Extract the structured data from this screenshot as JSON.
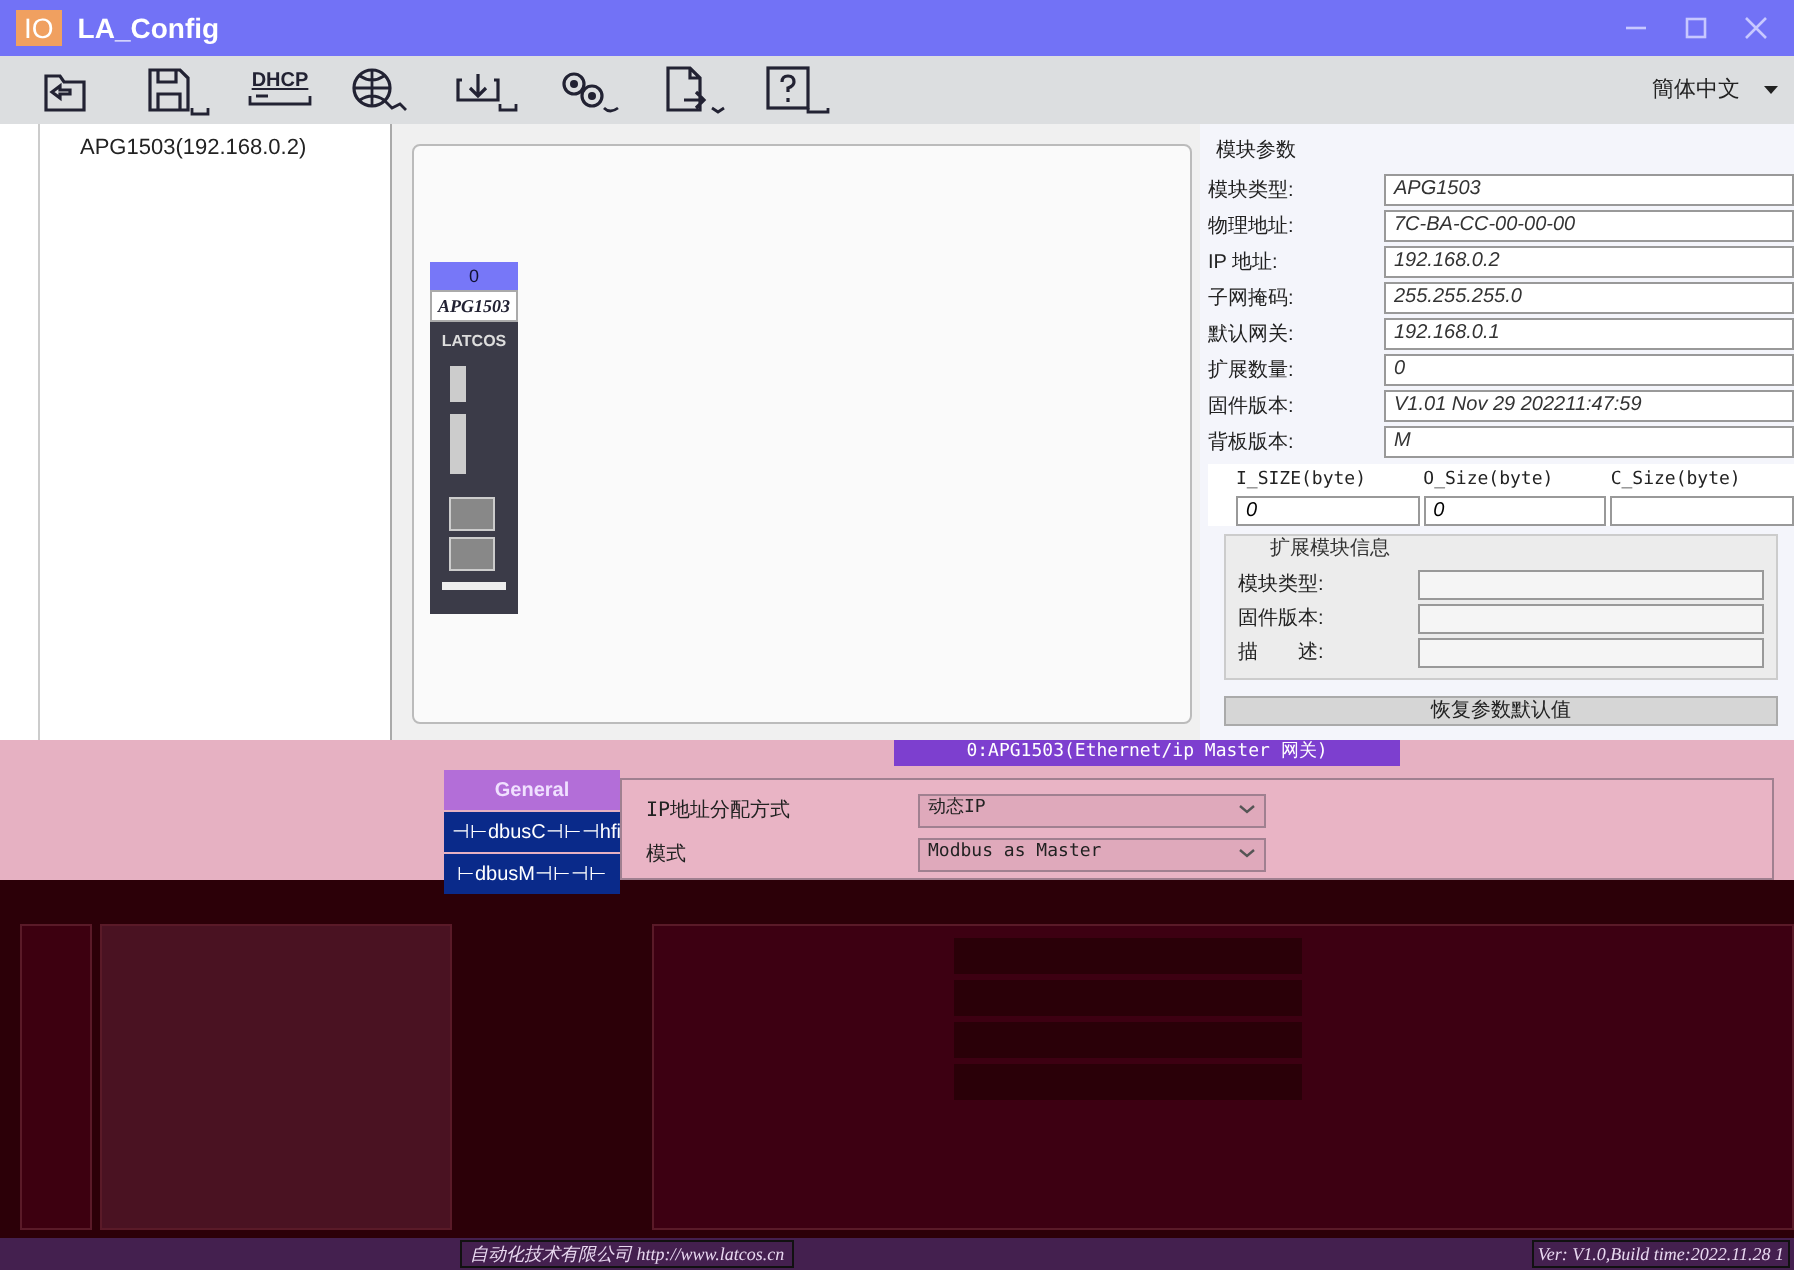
{
  "window": {
    "badge": "IO",
    "title": "LA_Config"
  },
  "toolbar": {
    "tools": [
      {
        "kind": "open"
      },
      {
        "kind": "save"
      },
      {
        "kind": "dhcp",
        "label": "DHCP"
      },
      {
        "kind": "network"
      },
      {
        "kind": "download"
      },
      {
        "kind": "settings"
      },
      {
        "kind": "export"
      },
      {
        "kind": "help"
      }
    ],
    "language": "簡体中文"
  },
  "tree": {
    "items": [
      {
        "label": "APG1503(192.168.0.2)",
        "selected": false
      }
    ]
  },
  "module": {
    "slot": "0",
    "model": "APG1503",
    "brand": "LATCOS"
  },
  "params": {
    "title": "模块参数",
    "fields": [
      {
        "label": "模块类型:",
        "value": "APG1503"
      },
      {
        "label": "物理地址:",
        "value": "7C-BA-CC-00-00-00"
      },
      {
        "label": "IP 地址:",
        "value": "192.168.0.2"
      },
      {
        "label": "子网掩码:",
        "value": "255.255.255.0"
      },
      {
        "label": "默认网关:",
        "value": "192.168.0.1"
      },
      {
        "label": "扩展数量:",
        "value": "0"
      },
      {
        "label": "固件版本:",
        "value": "V1.01 Nov 29 202211:47:59"
      },
      {
        "label": "背板版本:",
        "value": "M"
      }
    ],
    "sizes": [
      {
        "header": "I_SIZE(byte)",
        "value": "0"
      },
      {
        "header": "O_Size(byte)",
        "value": "0"
      },
      {
        "header": "C_Size(byte)"
      }
    ]
  },
  "extension": {
    "title": "扩展模块信息",
    "fields": [
      {
        "label": "模块类型:"
      },
      {
        "label": "固件版本:"
      },
      {
        "label": "描　　述:"
      }
    ]
  },
  "reset_button": "恢复参数默认值",
  "device_tag": "0:APG1503(Ethernet/ip Master 网关)",
  "tabs": [
    {
      "label": "General",
      "selected": true
    },
    {
      "label": "⊣⊢dbusC⊣⊢⊣hfi",
      "selected": false
    },
    {
      "label": "⊢dbusM⊣⊢⊣⊢",
      "selected": false
    }
  ],
  "settings": [
    {
      "label": "IP地址分配方式",
      "value": "动态IP"
    },
    {
      "label": "模式",
      "value": "Modbus as Master"
    }
  ],
  "status_bar": {
    "company": "自动化技术有限公司 http://www.latcos.cn",
    "version": "Ver: V1.0,Build time:2022.11.28 1"
  }
}
